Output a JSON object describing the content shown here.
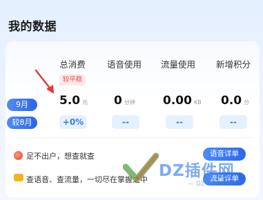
{
  "title": "我的数据",
  "columns": [
    "总消费",
    "语音使用",
    "流量使用",
    "新增积分"
  ],
  "badge": "较平稳",
  "rows": {
    "month_label": "9月",
    "prev_label": "较8月"
  },
  "values": [
    {
      "value": "5.0",
      "unit": "元"
    },
    {
      "value": "0",
      "unit": "分钟"
    },
    {
      "value": "0.00",
      "unit": "KB"
    },
    {
      "value": "0.0",
      "unit": "分"
    }
  ],
  "compare": [
    "+0%",
    "--",
    "--",
    "--"
  ],
  "tips": [
    {
      "text": "足不出户，想查就查",
      "button": "语音详单"
    },
    {
      "text": "查语音、查流量，一切尽在掌握之中",
      "button": "流量详单"
    }
  ],
  "watermark": {
    "text": "DZ插件网",
    "sub": "— DZ-X.NET —"
  },
  "colors": {
    "accent": "#2f7df0",
    "badge_red": "#e2504a",
    "arrow": "#e53935"
  }
}
